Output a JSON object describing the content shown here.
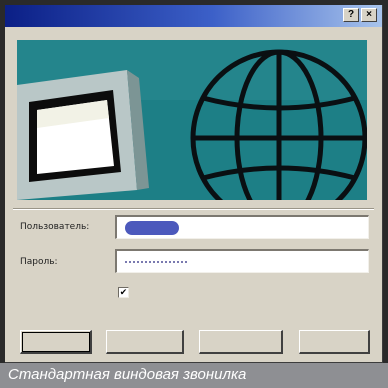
{
  "window": {
    "title": "",
    "help_label": "?",
    "close_label": "×"
  },
  "form": {
    "username_label": "Пользователь:",
    "password_label": "Пароль:",
    "username_value": "",
    "password_value": "",
    "save_password_checked": true,
    "save_password_label": ""
  },
  "buttons": {
    "dial_label": "",
    "cancel_label": "",
    "properties_label": "",
    "help_label": ""
  },
  "caption": "Стандартная виндовая звонилка",
  "icons": {
    "help": "question-icon",
    "close": "close-icon",
    "banner_monitor": "monitor-icon",
    "banner_globe": "globe-icon"
  },
  "colors": {
    "titlebar_start": "#0b1f86",
    "titlebar_end": "#a8c4ec",
    "dialog_face": "#d8d3c6",
    "banner_bg": "#1d7f86",
    "caption_bg": "#8e8f93"
  }
}
